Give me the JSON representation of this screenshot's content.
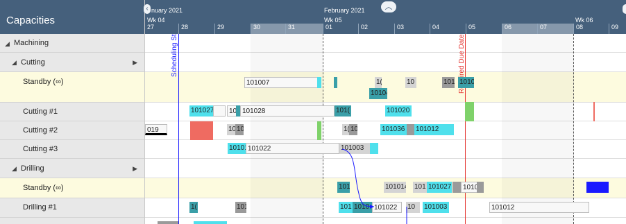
{
  "panel_title": "Capacities",
  "header": {
    "months": [
      "nuary 2021",
      "February 2021"
    ],
    "weeks": [
      "Wk 04",
      "Wk 05",
      "Wk 06"
    ],
    "days": [
      "27",
      "28",
      "29",
      "30",
      "31",
      "01",
      "02",
      "03",
      "04",
      "05",
      "06",
      "07",
      "08",
      "09"
    ]
  },
  "rows": [
    {
      "label": "Machining"
    },
    {
      "label": "Cutting"
    },
    {
      "label": "Standby (∞)"
    },
    {
      "label": "Cutting #1"
    },
    {
      "label": "Cutting #2"
    },
    {
      "label": "Cutting #3"
    },
    {
      "label": "Drilling"
    },
    {
      "label": "Standby (∞)"
    },
    {
      "label": "Drilling #1"
    }
  ],
  "markers": {
    "scheduling_start": "Scheduling Start",
    "required_due_date": "Required Due Date"
  },
  "bars": {
    "s1": "101007",
    "s2": "1(",
    "s3": "10",
    "s4": "101",
    "s5": "1010",
    "s6": "10104(",
    "c1a": "101027",
    "c1b": "10",
    "c1c": "101028",
    "c1d": "101(",
    "c1e": "101020",
    "c2a": "019",
    "c2b": "10",
    "c2c": "101",
    "c2d": "1(",
    "c2e": "10",
    "c2f": "101036",
    "c2g": "101012",
    "c3a": "10101",
    "c3b": "101022",
    "c3c": "101003",
    "d1": "101",
    "d2": "101014",
    "d3": "101",
    "d4": "101027",
    "d5": "101016",
    "d6": "101012",
    "e1": "1(",
    "e2": "101",
    "e3": "101",
    "e4": "1010",
    "e5": "101022",
    "e6": "10",
    "e7": "101003",
    "e8": "101012"
  },
  "colors": {
    "header": "#45607c",
    "accent": "#4fe0ec",
    "standby_row": "#fdfbdf"
  }
}
